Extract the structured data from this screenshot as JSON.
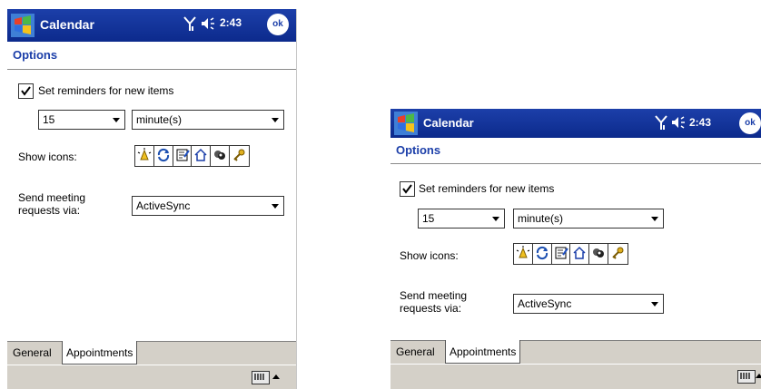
{
  "app": {
    "title": "Calendar",
    "time": "2:43",
    "ok_label": "ok"
  },
  "page": {
    "heading": "Options"
  },
  "reminders": {
    "checkbox_label": "Set reminders for new items",
    "checked": true,
    "amount": "15",
    "unit": "minute(s)"
  },
  "show_icons": {
    "label": "Show icons:",
    "icons": [
      "alarm-icon",
      "recurrence-icon",
      "note-icon",
      "home-icon",
      "meeting-icon",
      "key-icon"
    ]
  },
  "meeting": {
    "label_line1": "Send meeting",
    "label_line2": "requests via:",
    "value": "ActiveSync"
  },
  "tabs": [
    "General",
    "Appointments"
  ],
  "active_tab": "Appointments",
  "colors": {
    "titlebar": "#1c3fa9",
    "heading": "#1c3fa9",
    "bars": "#d4d0c8"
  }
}
